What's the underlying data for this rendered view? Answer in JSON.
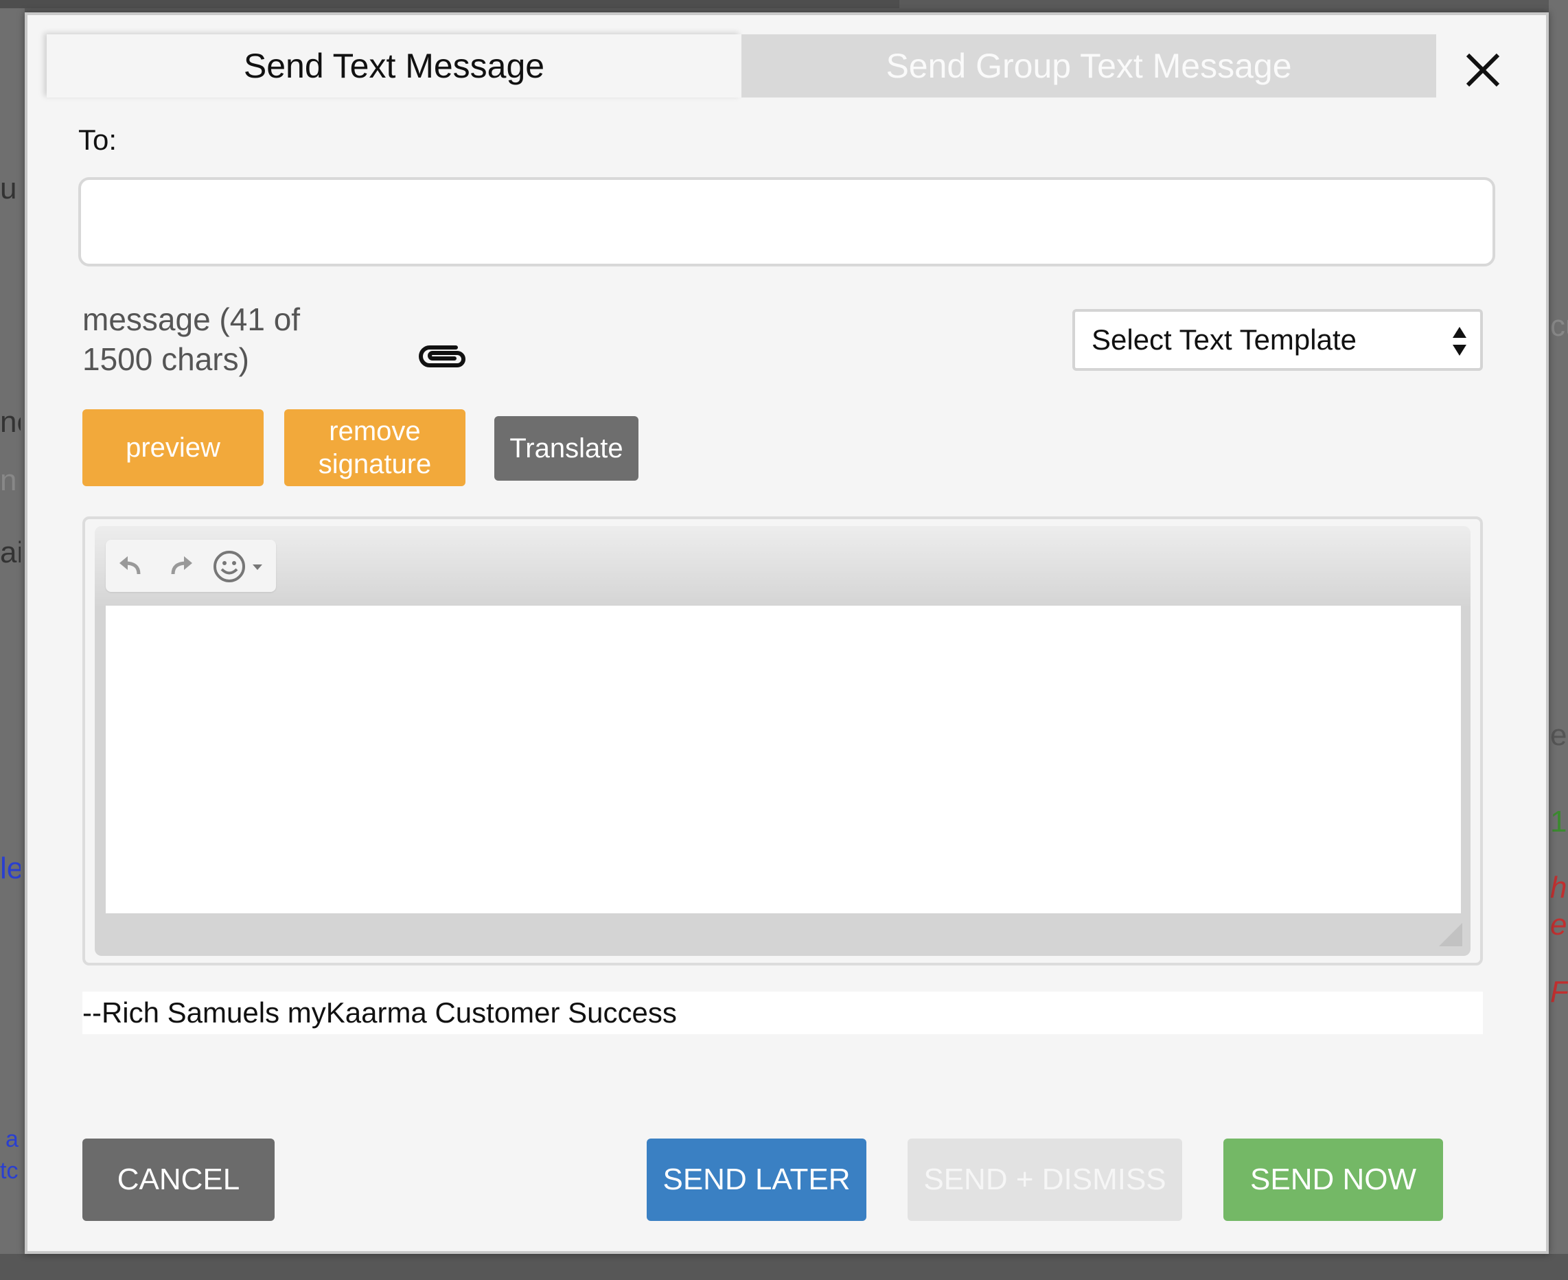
{
  "background": {
    "fragments": [
      "u",
      "ne",
      "n",
      "ai",
      "le",
      "a",
      "tc",
      "cu",
      "er",
      "1",
      "h",
      "e",
      "F"
    ]
  },
  "tabs": [
    {
      "label": "Send Text Message",
      "active": true
    },
    {
      "label": "Send Group Text Message",
      "active": false
    }
  ],
  "close": {
    "icon": "close-icon"
  },
  "to": {
    "label": "To:",
    "value": "",
    "placeholder": ""
  },
  "message": {
    "count_text": "message (41 of 1500 chars)"
  },
  "attach": {
    "icon": "paperclip-icon"
  },
  "template": {
    "selected": "Select Text Template"
  },
  "actions": {
    "preview": "preview",
    "remove_signature": "remove signature",
    "translate": "Translate"
  },
  "editor": {
    "toolbar": [
      "undo-icon",
      "redo-icon",
      "emoji-icon"
    ],
    "content": ""
  },
  "signature": "--Rich Samuels myKaarma Customer Success",
  "footer": {
    "cancel": "CANCEL",
    "send_later": "SEND LATER",
    "send_dismiss": "SEND + DISMISS",
    "send_now": "SEND NOW"
  },
  "colors": {
    "orange": "#f2a93b",
    "blue": "#3a80c3",
    "green": "#74b866",
    "gray": "#6b6b6b",
    "disabled": "#e2e2e2"
  }
}
